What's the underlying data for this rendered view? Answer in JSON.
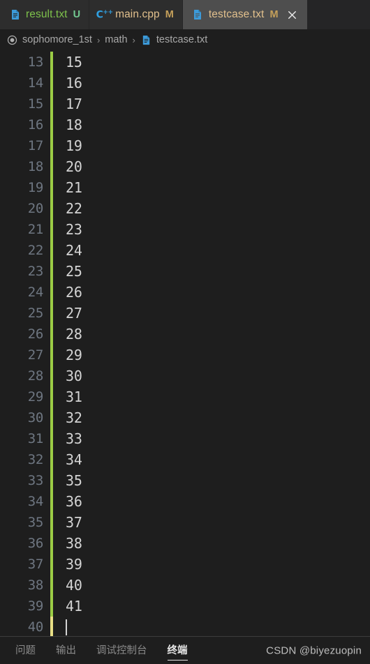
{
  "tabs": [
    {
      "label": "result.txt",
      "badge": "U",
      "badge_kind": "u",
      "icon": "text-file-icon",
      "state": "inactive",
      "color_class": "greenbright",
      "closable": false
    },
    {
      "label": "main.cpp",
      "badge": "M",
      "badge_kind": "m",
      "icon": "cpp-file-icon",
      "state": "inactive",
      "color_class": "yellow",
      "closable": false
    },
    {
      "label": "testcase.txt",
      "badge": "M",
      "badge_kind": "m",
      "icon": "text-file-icon",
      "state": "active",
      "color_class": "yellow",
      "closable": true
    }
  ],
  "breadcrumb": {
    "root_icon": "circle-filled-icon",
    "segments": [
      "sophomore_1st",
      "math",
      "testcase.txt"
    ],
    "separator": "›",
    "file_icon": "text-file-icon"
  },
  "editor": {
    "first_line_number": 13,
    "lines": [
      {
        "number": "13",
        "text": "15",
        "mark": "mod"
      },
      {
        "number": "14",
        "text": "16",
        "mark": "mod"
      },
      {
        "number": "15",
        "text": "17",
        "mark": "mod"
      },
      {
        "number": "16",
        "text": "18",
        "mark": "mod"
      },
      {
        "number": "17",
        "text": "19",
        "mark": "mod"
      },
      {
        "number": "18",
        "text": "20",
        "mark": "mod"
      },
      {
        "number": "19",
        "text": "21",
        "mark": "mod"
      },
      {
        "number": "20",
        "text": "22",
        "mark": "mod"
      },
      {
        "number": "21",
        "text": "23",
        "mark": "mod"
      },
      {
        "number": "22",
        "text": "24",
        "mark": "mod"
      },
      {
        "number": "23",
        "text": "25",
        "mark": "mod"
      },
      {
        "number": "24",
        "text": "26",
        "mark": "mod"
      },
      {
        "number": "25",
        "text": "27",
        "mark": "mod"
      },
      {
        "number": "26",
        "text": "28",
        "mark": "mod"
      },
      {
        "number": "27",
        "text": "29",
        "mark": "mod"
      },
      {
        "number": "28",
        "text": "30",
        "mark": "mod"
      },
      {
        "number": "29",
        "text": "31",
        "mark": "mod"
      },
      {
        "number": "30",
        "text": "32",
        "mark": "mod"
      },
      {
        "number": "31",
        "text": "33",
        "mark": "mod"
      },
      {
        "number": "32",
        "text": "34",
        "mark": "mod"
      },
      {
        "number": "33",
        "text": "35",
        "mark": "mod"
      },
      {
        "number": "34",
        "text": "36",
        "mark": "mod"
      },
      {
        "number": "35",
        "text": "37",
        "mark": "mod"
      },
      {
        "number": "36",
        "text": "38",
        "mark": "mod"
      },
      {
        "number": "37",
        "text": "39",
        "mark": "mod"
      },
      {
        "number": "38",
        "text": "40",
        "mark": "mod"
      },
      {
        "number": "39",
        "text": "41",
        "mark": "mod"
      },
      {
        "number": "40",
        "text": "",
        "mark": "cur",
        "cursor": true
      }
    ]
  },
  "panel": {
    "tabs": [
      {
        "label": "问题",
        "active": false
      },
      {
        "label": "输出",
        "active": false
      },
      {
        "label": "调试控制台",
        "active": false
      },
      {
        "label": "终端",
        "active": true
      }
    ],
    "watermark": "CSDN @biyezuopin"
  },
  "colors": {
    "editor_bg": "#1e1e1e",
    "tabbar_bg": "#252526",
    "tab_inactive_bg": "#2d2d2d",
    "tab_active_bg": "#4e4e4e",
    "line_number": "#6e7681",
    "code_text": "#d4d4d4",
    "modified_gutter": "#9bcc45",
    "cursor_gutter": "#e8df85",
    "untracked_green": "#7ec24b",
    "modified_yellow": "#e2c08d",
    "file_icon_blue": "#3c9ad9"
  }
}
